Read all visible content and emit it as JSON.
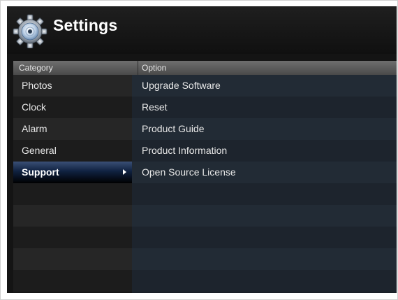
{
  "header": {
    "title": "Settings",
    "icon": "gear-disc-icon"
  },
  "columns": {
    "category": "Category",
    "option": "Option"
  },
  "categories": [
    {
      "label": "Photos"
    },
    {
      "label": "Clock"
    },
    {
      "label": "Alarm"
    },
    {
      "label": "General"
    },
    {
      "label": "Support",
      "selected": true
    }
  ],
  "options": [
    {
      "label": "Upgrade Software"
    },
    {
      "label": "Reset"
    },
    {
      "label": "Product Guide"
    },
    {
      "label": "Product Information"
    },
    {
      "label": "Open Source License"
    }
  ],
  "colors": {
    "selected_highlight": "#0f2140",
    "background": "#141414",
    "options_pane": "#1a2028"
  }
}
